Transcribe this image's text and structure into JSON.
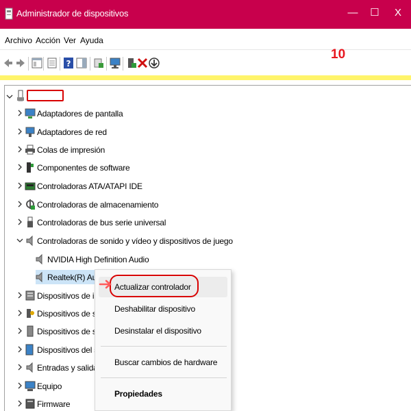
{
  "window": {
    "title": "Administrador de dispositivos",
    "minimize": "—",
    "maximize": "☐",
    "close": "X"
  },
  "menu": [
    "Archivo",
    "Acción",
    "Ver",
    "Ayuda"
  ],
  "annotation": "10",
  "toolbar_icons": [
    "back-icon",
    "forward-icon",
    "show-hide-tree-icon",
    "properties-icon",
    "help-icon",
    "action-pane-icon",
    "update-driver-icon",
    "monitor-icon",
    "add-legacy-icon",
    "uninstall-icon",
    "download-icon"
  ],
  "tree": {
    "root_label": "",
    "items": [
      {
        "label": "Adaptadores de pantalla",
        "icon": "display-adapter-icon"
      },
      {
        "label": "Adaptadores de red",
        "icon": "network-adapter-icon"
      },
      {
        "label": "Colas de impresión",
        "icon": "printer-icon"
      },
      {
        "label": "Componentes de software",
        "icon": "software-component-icon"
      },
      {
        "label": "Controladoras ATA/ATAPI IDE",
        "icon": "ide-controller-icon"
      },
      {
        "label": "Controladoras de almacenamiento",
        "icon": "storage-controller-icon"
      },
      {
        "label": "Controladoras de bus serie universal",
        "icon": "usb-icon"
      },
      {
        "label": "Controladoras de sonido y vídeo y dispositivos de juego",
        "icon": "speaker-icon",
        "expanded": true
      },
      {
        "label": "NVIDIA High Definition Audio",
        "icon": "speaker-icon",
        "child": true
      },
      {
        "label": "Realtek(R) Audio",
        "icon": "speaker-icon",
        "child": true,
        "selected": true
      },
      {
        "label": "Dispositivos de interf",
        "icon": "hid-icon"
      },
      {
        "label": "Dispositivos de segu",
        "icon": "security-device-icon"
      },
      {
        "label": "Dispositivos de softw",
        "icon": "software-device-icon"
      },
      {
        "label": "Dispositivos del siste",
        "icon": "system-device-icon"
      },
      {
        "label": "Entradas y salidas de",
        "icon": "audio-io-icon"
      },
      {
        "label": "Equipo",
        "icon": "computer-icon"
      },
      {
        "label": "Firmware",
        "icon": "firmware-icon"
      }
    ]
  },
  "context_menu": {
    "update_driver": "Actualizar controlador",
    "disable_device": "Deshabilitar dispositivo",
    "uninstall_device": "Desinstalar el dispositivo",
    "scan_hardware": "Buscar cambios de hardware",
    "properties": "Propiedades"
  },
  "colors": {
    "titlebar": "#c8004c",
    "highlight_bar": "#fff46a",
    "annotation": "#e8171f",
    "selection": "#cce4f7"
  }
}
